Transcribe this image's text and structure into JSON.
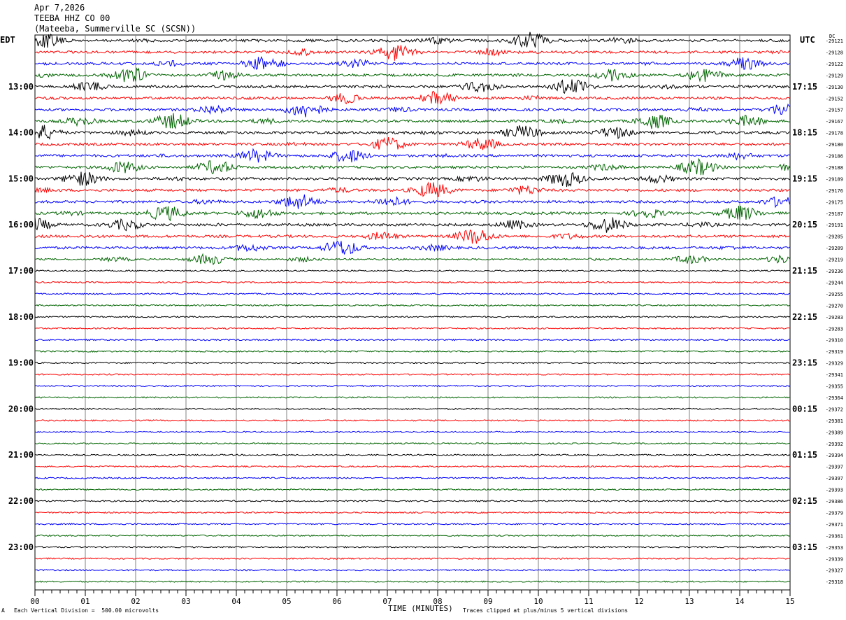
{
  "header": {
    "date": "Apr 7,2026",
    "station": "TEEBA HHZ CO 00",
    "location": "(Mateeba, Summerville SC (SCSN))"
  },
  "left_zone": "EDT",
  "right_zone": "UTC",
  "dc_label": "DC",
  "footer": {
    "scale_note": "Each Vertical Division =  500.00 microvolts",
    "xlabel": "TIME (MINUTES)",
    "clip_note": "Traces clipped at plus/minus 5 vertical divisions",
    "corner_mark": "A"
  },
  "colors": {
    "black": "#000000",
    "red": "#ff0000",
    "blue": "#0000ff",
    "green": "#006400",
    "grid": "#808080"
  },
  "chart_data": {
    "type": "line",
    "title": "TEEBA HHZ CO 00",
    "xlabel": "TIME (MINUTES)",
    "xlim": [
      0,
      15
    ],
    "x_ticks": [
      "00",
      "01",
      "02",
      "03",
      "04",
      "05",
      "06",
      "07",
      "08",
      "09",
      "10",
      "11",
      "12",
      "13",
      "14",
      "15"
    ],
    "hours_left": [
      "13:00",
      "14:00",
      "15:00",
      "16:00",
      "17:00",
      "18:00",
      "19:00",
      "20:00",
      "21:00",
      "22:00",
      "23:00"
    ],
    "hours_right": [
      "17:15",
      "18:15",
      "19:15",
      "20:15",
      "21:15",
      "22:15",
      "23:15",
      "00:15",
      "01:15",
      "02:15",
      "03:15"
    ],
    "trace_color_cycle": [
      "#000000",
      "#ff0000",
      "#0000ff",
      "#006400"
    ],
    "dc_offsets": [
      -29121,
      -29128,
      -29122,
      -29129,
      -29130,
      -29152,
      -29157,
      -29167,
      -29178,
      -29180,
      -29186,
      -29188,
      -29189,
      -29176,
      -29175,
      -29187,
      -29191,
      -29205,
      -29209,
      -29219,
      -29236,
      -29244,
      -29255,
      -29270,
      -29283,
      -29283,
      -29310,
      -29319,
      -29329,
      -29341,
      -29355,
      -29364,
      -29372,
      -29381,
      -29389,
      -29392,
      -29394,
      -29397,
      -29397,
      -29393,
      -29386,
      -29379,
      -29371,
      -29361,
      -29353,
      -29339,
      -29327,
      -29318
    ],
    "noise_level": [
      3,
      3,
      3,
      3,
      3,
      3,
      3,
      3,
      3,
      3,
      3,
      3,
      3,
      3,
      3,
      3,
      3,
      3,
      3,
      2,
      1,
      1,
      1,
      1,
      1,
      1,
      1,
      1,
      1,
      1,
      1,
      1,
      1,
      1,
      1,
      1,
      1,
      1,
      1,
      1,
      1,
      1,
      1,
      1,
      1,
      1,
      1,
      1
    ]
  }
}
